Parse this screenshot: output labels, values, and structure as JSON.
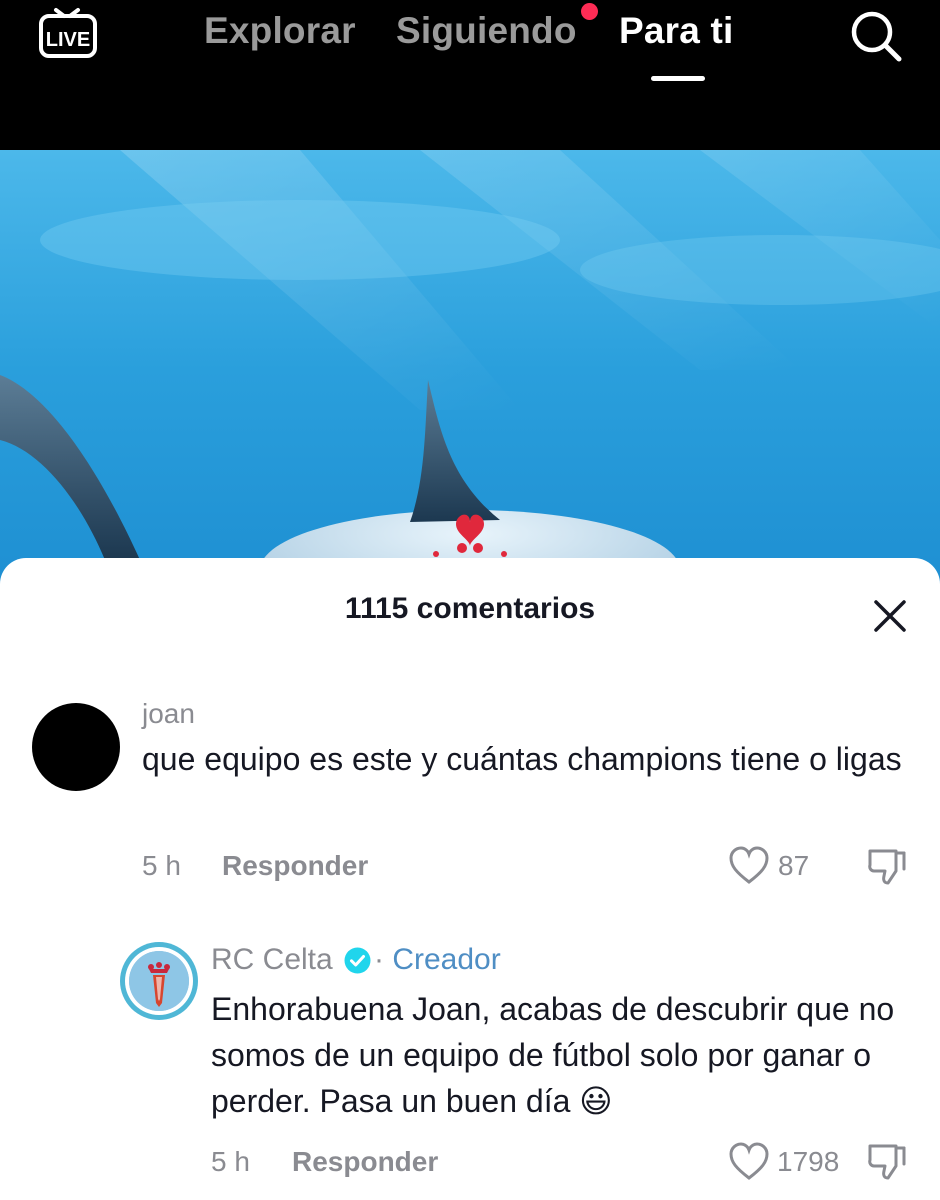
{
  "nav": {
    "live_label": "LIVE",
    "tabs": [
      {
        "label": "Explorar"
      },
      {
        "label": "Siguiendo",
        "has_notification": true
      },
      {
        "label": "Para ti",
        "active": true
      }
    ],
    "search_icon": "search-icon"
  },
  "comments_sheet": {
    "title": "1115 comentarios",
    "close_icon": "close-icon",
    "comments": [
      {
        "username": "joan",
        "text": "que equipo es este y cuántas champions tiene o ligas",
        "time": "5 h",
        "reply_label": "Responder",
        "likes": "87"
      }
    ],
    "reply": {
      "username": "RC Celta",
      "verified": true,
      "badge": "Creador",
      "badge_separator": "·",
      "text": "Enhorabuena Joan, acabas de descubrir que no somos de un equipo de fútbol solo por ganar o perder. Pasa un buen día 😃",
      "time": "5 h",
      "reply_label": "Responder",
      "likes": "1798"
    }
  },
  "colors": {
    "accent_red": "#fe2c55",
    "creator_blue": "#4f8ec4",
    "verified_blue": "#20d5ec",
    "video_blue": "#2aa4e0"
  }
}
